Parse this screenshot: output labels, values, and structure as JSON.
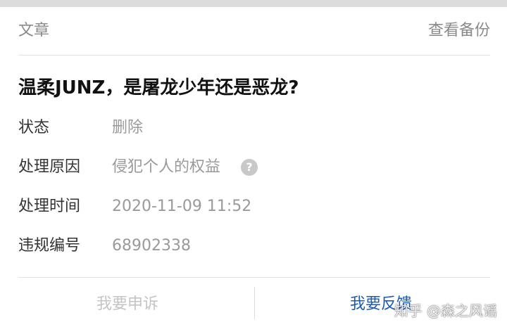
{
  "header": {
    "section_label": "文章",
    "backup_link": "查看备份"
  },
  "article": {
    "title": "温柔JUNZ，是屠龙少年还是恶龙?"
  },
  "details": {
    "status_label": "状态",
    "status_value": "删除",
    "reason_label": "处理原因",
    "reason_value": "侵犯个人的权益",
    "time_label": "处理时间",
    "time_value": "2020-11-09 11:52",
    "violation_label": "违规编号",
    "violation_value": "68902338",
    "help_glyph": "?"
  },
  "actions": {
    "appeal_label": "我要申诉",
    "feedback_label": "我要反馈"
  },
  "watermark": {
    "text": "知乎 @森之风谣"
  },
  "colors": {
    "accent": "#1a5bb8",
    "muted": "#9a9a9a",
    "disabled": "#c4c4c4"
  }
}
